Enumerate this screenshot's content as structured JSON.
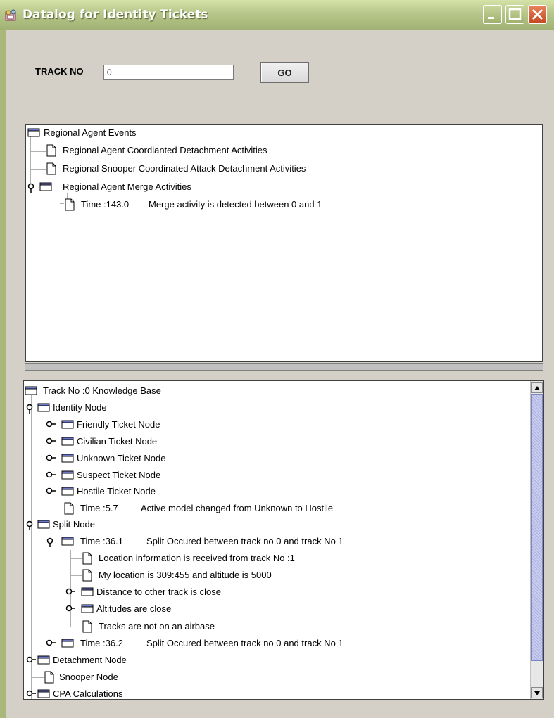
{
  "window": {
    "title": "Datalog for Identity Tickets"
  },
  "search": {
    "label": "TRACK NO",
    "value": "0",
    "button_label": "GO"
  },
  "events_tree": {
    "root": "Regional Agent Events",
    "items": [
      "Regional Agent Coordianted Detachment Activities",
      "Regional Snooper Coordinated Attack Detachment Activities",
      "Regional Agent Merge Activities"
    ],
    "merge_child": {
      "time": "Time :143.0",
      "message": "Merge activity is detected between 0 and 1"
    }
  },
  "kb_tree": {
    "root": "Track No :0 Knowledge Base",
    "identity_node": {
      "label": "Identity Node",
      "children": [
        "Friendly Ticket Node",
        "Civilian Ticket Node",
        "Unknown Ticket Node",
        "Suspect Ticket Node",
        "Hostile Ticket Node"
      ],
      "time_leaf": {
        "time": "Time :5.7",
        "message": "Active model changed from Unknown to Hostile"
      }
    },
    "split_node": {
      "label": "Split Node",
      "time1": {
        "time": "Time :36.1",
        "message": "Split Occured between track no 0 and track No 1",
        "children": [
          "Location information is received from track No :1",
          "My location is 309:455 and altitude is 5000",
          "Distance to other track is close",
          "Altitudes are close",
          "Tracks are not on an airbase"
        ]
      },
      "time2": {
        "time": "Time :36.2",
        "message": "Split Occured between track no 0 and track No 1"
      }
    },
    "bottom_items": [
      "Detachment Node",
      "Snooper Node",
      "CPA Calculations"
    ]
  },
  "colors": {
    "titlebar": "#b7c68a",
    "close_button": "#c4481f",
    "scroll_thumb": "#aab0e0"
  }
}
